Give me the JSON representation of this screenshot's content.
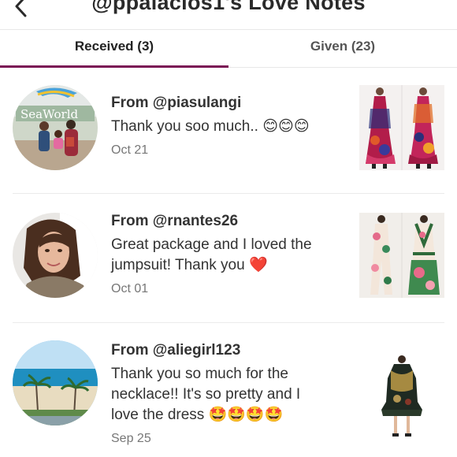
{
  "header": {
    "title": "@ppalacios1's Love Notes",
    "back_icon": "chevron-left-icon"
  },
  "tabs": {
    "received_label": "Received (3)",
    "given_label": "Given (23)",
    "active": "received",
    "accent_color": "#7a1154"
  },
  "notes": [
    {
      "from": "From @piasulangi",
      "message": "Thank you soo much.. 😊😊😊",
      "date": "Oct 21",
      "avatar_sign_text": "SeaWorld"
    },
    {
      "from": "From @rnantes26",
      "message": "Great package and I loved the jumpsuit! Thank you ❤️",
      "date": "Oct 01"
    },
    {
      "from": "From @aliegirl123",
      "message": "Thank you so much for the necklace!! It's so pretty and I love the dress 🤩🤩🤩🤩",
      "date": "Sep 25"
    }
  ]
}
